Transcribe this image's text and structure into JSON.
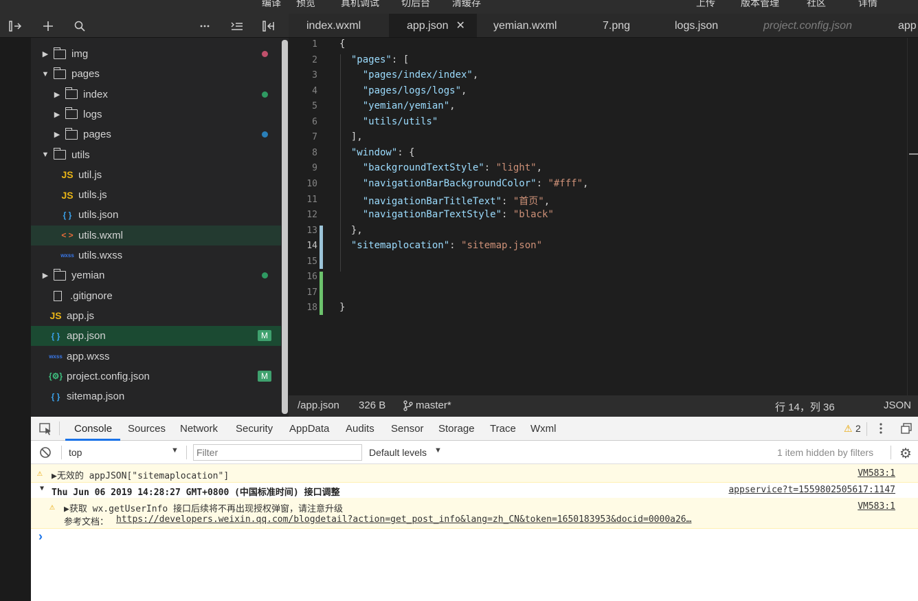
{
  "top_menu": [
    "编译",
    "预览",
    "真机调试",
    "切后台",
    "清缓存",
    "上传",
    "版本管理",
    "社区",
    "详情"
  ],
  "toolbar": {
    "icons": [
      "toggle-sidebar-icon",
      "add-icon",
      "search-icon",
      "more-icon",
      "collapse-icon",
      "split-icon"
    ]
  },
  "tabs": [
    "index.wxml",
    "app.json",
    "yemian.wxml",
    "7.png",
    "logs.json",
    "project.config.json",
    "app"
  ],
  "active_tab": "app.json",
  "tree": [
    {
      "label": "img",
      "type": "folder",
      "arrow": "▶",
      "indent": 0
    },
    {
      "label": "pages",
      "type": "folder",
      "arrow": "▼",
      "indent": 0
    },
    {
      "label": "index",
      "type": "folder",
      "arrow": "▶",
      "indent": 1
    },
    {
      "label": "logs",
      "type": "folder",
      "arrow": "▶",
      "indent": 1
    },
    {
      "label": "pages",
      "type": "folder",
      "arrow": "▶",
      "indent": 1
    },
    {
      "label": "utils",
      "type": "folder",
      "arrow": "▼",
      "indent": 0
    },
    {
      "label": "util.js",
      "type": "js",
      "icon": "JS",
      "indent": 1
    },
    {
      "label": "utils.js",
      "type": "js",
      "icon": "JS",
      "indent": 1
    },
    {
      "label": "utils.json",
      "type": "json",
      "icon": "{ }",
      "indent": 1
    },
    {
      "label": "utils.wxml",
      "type": "wxml",
      "icon": "< >",
      "indent": 1
    },
    {
      "label": "utils.wxss",
      "type": "wxss",
      "icon": "wxss",
      "indent": 1
    },
    {
      "label": "yemian",
      "type": "folder",
      "arrow": "▶",
      "indent": 0
    },
    {
      "label": ".gitignore",
      "type": "file",
      "indent": 0
    },
    {
      "label": "app.js",
      "type": "js",
      "icon": "JS",
      "indent": 0
    },
    {
      "label": "app.json",
      "type": "json",
      "icon": "{ }",
      "indent": 0
    },
    {
      "label": "app.wxss",
      "type": "wxss",
      "icon": "wxss",
      "indent": 0
    },
    {
      "label": "project.config.json",
      "type": "config",
      "icon": "{⚙}",
      "indent": 0
    },
    {
      "label": "sitemap.json",
      "type": "json",
      "icon": "{ }",
      "indent": 0
    }
  ],
  "modified_badge": "M",
  "colors": {
    "js": "#e8b417",
    "json": "#3aa0e8",
    "wxml": "#e86b3a",
    "wxss": "#3a78e8",
    "config": "#3fbf7f",
    "dot_pink": "#c0506b",
    "dot_green": "#2f9a62",
    "dot_blue": "#2a7fb8"
  },
  "editor": {
    "lines": [
      [
        {
          "t": "{",
          "c": "p"
        }
      ],
      [
        {
          "t": "  ",
          "c": "p"
        },
        {
          "t": "\"pages\"",
          "c": "k"
        },
        {
          "t": ": [",
          "c": "p"
        }
      ],
      [
        {
          "t": "    ",
          "c": "p"
        },
        {
          "t": "\"pages/index/index\"",
          "c": "k"
        },
        {
          "t": ",",
          "c": "p"
        }
      ],
      [
        {
          "t": "    ",
          "c": "p"
        },
        {
          "t": "\"pages/logs/logs\"",
          "c": "k"
        },
        {
          "t": ",",
          "c": "p"
        }
      ],
      [
        {
          "t": "    ",
          "c": "p"
        },
        {
          "t": "\"yemian/yemian\"",
          "c": "k"
        },
        {
          "t": ",",
          "c": "p"
        }
      ],
      [
        {
          "t": "    ",
          "c": "p"
        },
        {
          "t": "\"utils/utils\"",
          "c": "k"
        }
      ],
      [
        {
          "t": "  ],",
          "c": "p"
        }
      ],
      [
        {
          "t": "  ",
          "c": "p"
        },
        {
          "t": "\"window\"",
          "c": "k"
        },
        {
          "t": ": {",
          "c": "p"
        }
      ],
      [
        {
          "t": "    ",
          "c": "p"
        },
        {
          "t": "\"backgroundTextStyle\"",
          "c": "k"
        },
        {
          "t": ": ",
          "c": "p"
        },
        {
          "t": "\"light\"",
          "c": "s"
        },
        {
          "t": ",",
          "c": "p"
        }
      ],
      [
        {
          "t": "    ",
          "c": "p"
        },
        {
          "t": "\"navigationBarBackgroundColor\"",
          "c": "k"
        },
        {
          "t": ": ",
          "c": "p"
        },
        {
          "t": "\"#fff\"",
          "c": "s"
        },
        {
          "t": ",",
          "c": "p"
        }
      ],
      [
        {
          "t": "    ",
          "c": "p"
        },
        {
          "t": "\"navigationBarTitleText\"",
          "c": "k"
        },
        {
          "t": ": ",
          "c": "p"
        },
        {
          "t": "\"首页\"",
          "c": "s"
        },
        {
          "t": ",",
          "c": "p"
        }
      ],
      [
        {
          "t": "    ",
          "c": "p"
        },
        {
          "t": "\"navigationBarTextStyle\"",
          "c": "k"
        },
        {
          "t": ": ",
          "c": "p"
        },
        {
          "t": "\"black\"",
          "c": "s"
        }
      ],
      [
        {
          "t": "  },",
          "c": "p"
        }
      ],
      [
        {
          "t": "  ",
          "c": "p"
        },
        {
          "t": "\"sitemaplocation\"",
          "c": "k"
        },
        {
          "t": ": ",
          "c": "p"
        },
        {
          "t": "\"sitemap.json\"",
          "c": "s"
        }
      ],
      [],
      [],
      [],
      [
        {
          "t": "}",
          "c": "p"
        }
      ]
    ],
    "current_line": 14
  },
  "status": {
    "path": "/app.json",
    "size": "326 B",
    "branch": "master*",
    "position": "行 14，列 36",
    "language": "JSON"
  },
  "devtools": {
    "tabs": [
      "Console",
      "Sources",
      "Network",
      "Security",
      "AppData",
      "Audits",
      "Sensor",
      "Storage",
      "Trace",
      "Wxml"
    ],
    "active_tab": "Console",
    "warnings_count": "2",
    "context": "top",
    "filter_placeholder": "Filter",
    "levels": "Default levels",
    "hidden_info": "1 item hidden by filters",
    "messages": [
      {
        "text": "▶无效的 appJSON[\"sitemaplocation\"]",
        "source": "VM583:1"
      },
      {
        "text": "Thu Jun 06 2019 14:28:27 GMT+0800 (中国标准时间) 接口调整",
        "source": "appservice?t=1559802505617:1147"
      },
      {
        "text": "▶获取 wx.getUserInfo 接口后续将不再出现授权弹窗，请注意升级",
        "text2_prefix": "参考文档：",
        "link": "https://developers.weixin.qq.com/blogdetail?action=get_post_info&lang=zh_CN&token=1650183953&docid=0000a26…",
        "source": "VM583:1"
      }
    ],
    "prompt": "›"
  }
}
